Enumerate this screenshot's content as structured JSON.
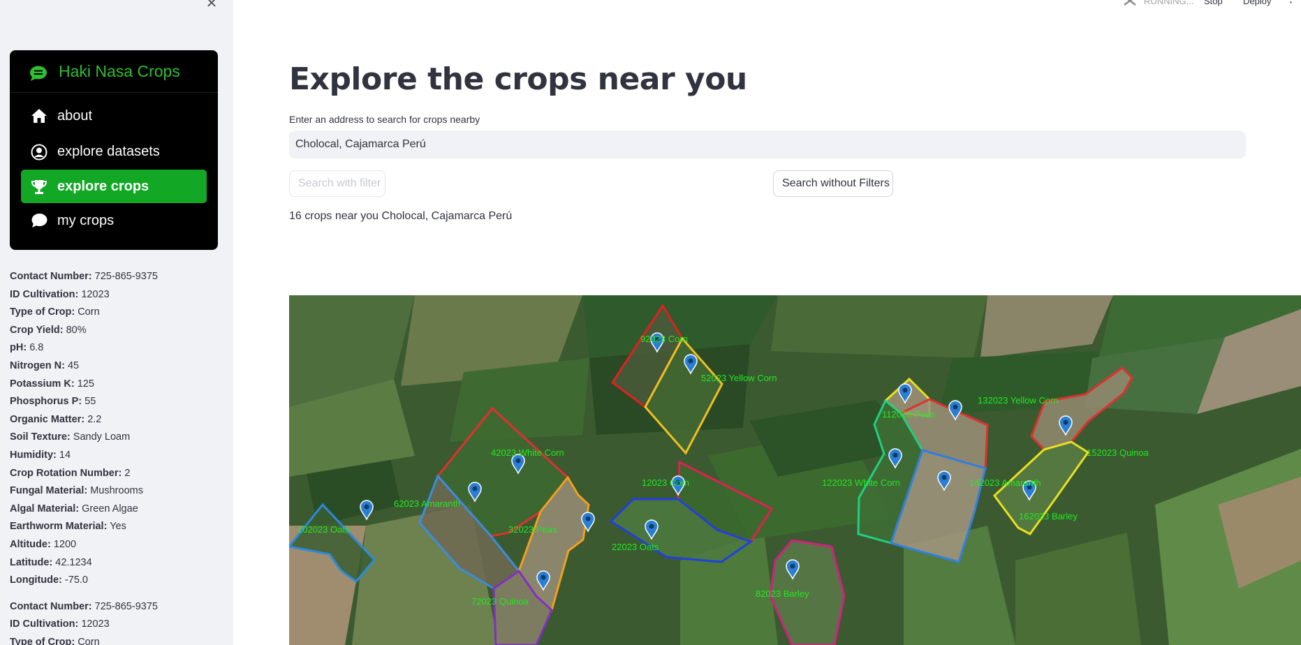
{
  "sidebar": {
    "close_icon": "close-icon",
    "menu": {
      "title": "Haki Nasa Crops",
      "title_icon": "chat-dots-icon",
      "items": [
        {
          "label": "about",
          "icon": "house-icon",
          "active": false
        },
        {
          "label": "explore datasets",
          "icon": "person-circle-icon",
          "active": false
        },
        {
          "label": "explore crops",
          "icon": "trophy-icon",
          "active": true
        },
        {
          "label": "my crops",
          "icon": "chat-icon",
          "active": false
        }
      ]
    },
    "records": [
      {
        "contact_number": {
          "label": "Contact Number:",
          "value": "725-865-9375"
        },
        "id_cultivation": {
          "label": "ID Cultivation:",
          "value": "12023"
        },
        "type_of_crop": {
          "label": "Type of Crop:",
          "value": "Corn"
        },
        "crop_yield": {
          "label": "Crop Yield:",
          "value": "80%"
        },
        "ph": {
          "label": "pH:",
          "value": "6.8"
        },
        "nitrogen": {
          "label": "Nitrogen N:",
          "value": "45"
        },
        "potassium": {
          "label": "Potassium K:",
          "value": "125"
        },
        "phosphorus": {
          "label": "Phosphorus P:",
          "value": "55"
        },
        "organic_matter": {
          "label": "Organic Matter:",
          "value": "2.2"
        },
        "soil_texture": {
          "label": "Soil Texture:",
          "value": "Sandy Loam"
        },
        "humidity": {
          "label": "Humidity:",
          "value": "14"
        },
        "crop_rotation": {
          "label": "Crop Rotation Number:",
          "value": "2"
        },
        "fungal_material": {
          "label": "Fungal Material:",
          "value": "Mushrooms"
        },
        "algal_material": {
          "label": "Algal Material:",
          "value": "Green Algae"
        },
        "earthworm_material": {
          "label": "Earthworm Material:",
          "value": "Yes"
        },
        "altitude": {
          "label": "Altitude:",
          "value": "1200"
        },
        "latitude": {
          "label": "Latitude:",
          "value": "42.1234"
        },
        "longitude": {
          "label": "Longitude:",
          "value": "-75.0"
        }
      },
      {
        "contact_number": {
          "label": "Contact Number:",
          "value": "725-865-9375"
        },
        "id_cultivation": {
          "label": "ID Cultivation:",
          "value": "12023"
        },
        "type_of_crop": {
          "label": "Type of Crop:",
          "value": "Corn"
        }
      }
    ]
  },
  "topbar": {
    "status": "RUNNING...",
    "stop": "Stop",
    "deploy": "Deploy",
    "status_icon": "running-icon",
    "menu_icon": "more-vertical-icon"
  },
  "main": {
    "title": "Explore the crops near you",
    "search": {
      "label": "Enter an address to search for crops nearby",
      "value": "Cholocal, Cajamarca Perú"
    },
    "buttons": {
      "filter": "Search with filter",
      "no_filter": "Search without Filters"
    },
    "result_text": "16 crops near you Cholocal, Cajamarca Perú"
  },
  "map": {
    "plots": [
      {
        "label": "92023 Corn",
        "color": "#e02020"
      },
      {
        "label": "52023 Yellow Corn",
        "color": "#f0c020"
      },
      {
        "label": "42023 White Corn",
        "color": "#e03030"
      },
      {
        "label": "62023 Amaranth",
        "color": "#3a8de0"
      },
      {
        "label": "102023 Oats",
        "color": "#2a8ae0"
      },
      {
        "label": "32023 Peas",
        "color": "#f0a020"
      },
      {
        "label": "72023 Quinoa",
        "color": "#8030c0"
      },
      {
        "label": "12023 Corn",
        "color": "#e02050"
      },
      {
        "label": "22023 Oats",
        "color": "#2040e0"
      },
      {
        "label": "82023 Barley",
        "color": "#d02080"
      },
      {
        "label": "112023 Peas",
        "color": "#e8e020"
      },
      {
        "label": "132023 Yellow Corn",
        "color": "#e03030"
      },
      {
        "label": "122023 White Corn",
        "color": "#20d080"
      },
      {
        "label": "142023 Amaranth",
        "color": "#3080e0"
      },
      {
        "label": "152023 Quinoa",
        "color": "#e03030"
      },
      {
        "label": "162023 Barley",
        "color": "#e8e020"
      }
    ],
    "label_color": "#22e822",
    "marker_color": "#2a7fd4"
  }
}
